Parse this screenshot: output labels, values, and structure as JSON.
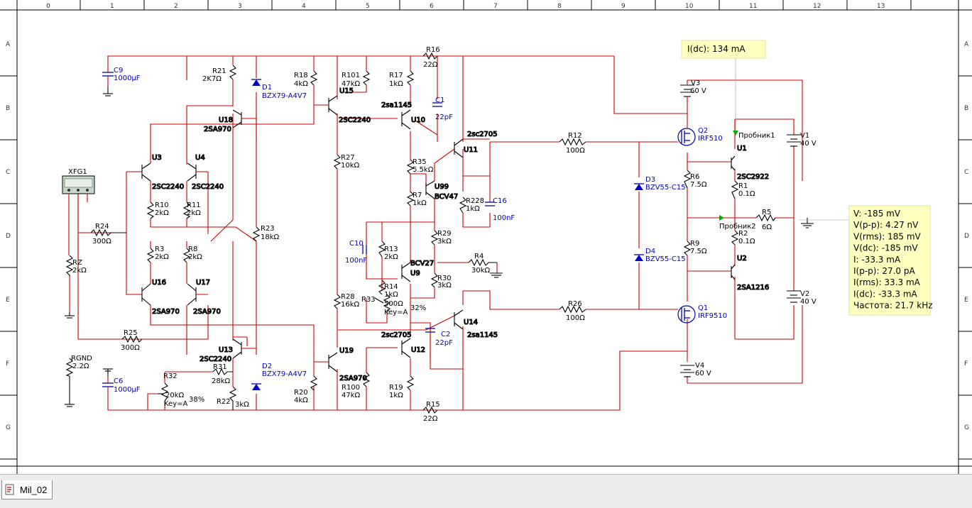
{
  "ruler": {
    "columns": [
      "0",
      "1",
      "2",
      "3",
      "4",
      "5",
      "6",
      "7",
      "8",
      "9",
      "10",
      "11",
      "12",
      "13"
    ],
    "rows": [
      "A",
      "B",
      "C",
      "D",
      "E",
      "F",
      "G"
    ]
  },
  "components": {
    "C9": {
      "ref": "C9",
      "val": "1000µF"
    },
    "C6": {
      "ref": "C6",
      "val": "1000µF"
    },
    "XFG1": {
      "ref": "XFG1"
    },
    "R24": {
      "ref": "R24",
      "val": "300Ω"
    },
    "RZ": {
      "ref": "RZ",
      "val": "2kΩ"
    },
    "R25": {
      "ref": "R25",
      "val": "300Ω"
    },
    "RGND": {
      "ref": "RGND",
      "val": "2.2Ω"
    },
    "U3": {
      "ref": "U3",
      "val": "2SC2240"
    },
    "U4": {
      "ref": "U4",
      "val": "2SC2240"
    },
    "R10": {
      "ref": "R10",
      "val": "2kΩ"
    },
    "R11": {
      "ref": "R11",
      "val": "2kΩ"
    },
    "R3": {
      "ref": "R3",
      "val": "2kΩ"
    },
    "R8": {
      "ref": "R8",
      "val": "2kΩ"
    },
    "U16": {
      "ref": "U16",
      "val": "2SA970"
    },
    "U17": {
      "ref": "U17",
      "val": "2SA970"
    },
    "R21": {
      "ref": "R21",
      "val": "2K7Ω"
    },
    "U18": {
      "ref": "U18",
      "val": "2SA970"
    },
    "D1": {
      "ref": "D1",
      "val": "BZX79-A4V7"
    },
    "D2": {
      "ref": "D2",
      "val": "BZX79-A4V7"
    },
    "R23": {
      "ref": "R23",
      "val": "18kΩ"
    },
    "U13": {
      "ref": "U13",
      "val": "2SC2240"
    },
    "R31": {
      "ref": "R31",
      "val": "28kΩ"
    },
    "R32": {
      "ref": "R32",
      "val": "20kΩ",
      "key": "Key=A",
      "pct": "38%"
    },
    "R22": {
      "ref": "R22",
      "val": "3kΩ"
    },
    "R18": {
      "ref": "R18",
      "val": "4kΩ"
    },
    "R20": {
      "ref": "R20",
      "val": "4kΩ"
    },
    "R101": {
      "ref": "R101",
      "val": "47kΩ"
    },
    "U15": {
      "ref": "U15",
      "val": "2SC2240"
    },
    "R27": {
      "ref": "R27",
      "val": "10kΩ"
    },
    "R28": {
      "ref": "R28",
      "val": "16kΩ"
    },
    "U19": {
      "ref": "U19",
      "val": "2SA970"
    },
    "R100": {
      "ref": "R100",
      "val": "47kΩ"
    },
    "R17": {
      "ref": "R17",
      "val": "1kΩ"
    },
    "U10": {
      "ref": "U10",
      "val": "2sa1145"
    },
    "R35": {
      "ref": "R35",
      "val": "5.5kΩ"
    },
    "U99": {
      "ref": "U99",
      "val": "BCV47"
    },
    "R7": {
      "ref": "R7",
      "val": "1kΩ"
    },
    "C10": {
      "ref": "C10",
      "val": "100nF"
    },
    "R13": {
      "ref": "R13",
      "val": "2kΩ"
    },
    "U9": {
      "ref": "U9",
      "val": "BCV27"
    },
    "R14": {
      "ref": "R14",
      "val": "1kΩ"
    },
    "R33": {
      "ref": "R33",
      "val": "500Ω",
      "key": "Key=A",
      "pct": "32%"
    },
    "U12": {
      "ref": "U12",
      "val": "2sc2705"
    },
    "R19": {
      "ref": "R19",
      "val": "1kΩ"
    },
    "R29": {
      "ref": "R29",
      "val": "3kΩ"
    },
    "R30": {
      "ref": "R30",
      "val": "3kΩ"
    },
    "C1": {
      "ref": "C1",
      "val": "22pF"
    },
    "C2": {
      "ref": "C2",
      "val": "22pF"
    },
    "R16": {
      "ref": "R16",
      "val": "22Ω"
    },
    "R15": {
      "ref": "R15",
      "val": "22Ω"
    },
    "U11": {
      "ref": "U11",
      "val": "2sc2705"
    },
    "U14": {
      "ref": "U14",
      "val": "2sa1145"
    },
    "R228": {
      "ref": "R228",
      "val": "1kΩ"
    },
    "C16": {
      "ref": "C16",
      "val": "100nF"
    },
    "R4": {
      "ref": "R4",
      "val": "30kΩ"
    },
    "R12": {
      "ref": "R12",
      "val": "100Ω"
    },
    "R26": {
      "ref": "R26",
      "val": "100Ω"
    },
    "D3": {
      "ref": "D3",
      "val": "BZV55-C15"
    },
    "D4": {
      "ref": "D4",
      "val": "BZV55-C15"
    },
    "V3": {
      "ref": "V3",
      "val": "60 V"
    },
    "V4": {
      "ref": "V4",
      "val": "60 V"
    },
    "Q2": {
      "ref": "Q2",
      "val": "IRF510"
    },
    "Q1": {
      "ref": "Q1",
      "val": "IRF9510"
    },
    "R6": {
      "ref": "R6",
      "val": "7.5Ω"
    },
    "R9": {
      "ref": "R9",
      "val": "7.5Ω"
    },
    "U1": {
      "ref": "U1",
      "val": "2SC2922"
    },
    "U2": {
      "ref": "U2",
      "val": "2SA1216"
    },
    "R1": {
      "ref": "R1",
      "val": "0.1Ω"
    },
    "R2": {
      "ref": "R2",
      "val": "0.1Ω"
    },
    "R5": {
      "ref": "R5",
      "val": "6Ω"
    },
    "V1": {
      "ref": "V1",
      "val": "40 V"
    },
    "V2": {
      "ref": "V2",
      "val": "40 V"
    }
  },
  "probes": {
    "probe1": "Пробник1",
    "probe2": "Пробник2",
    "probe_top_reading": "I(dc): 134 mA",
    "probe2_readings": [
      "V: -185 mV",
      "V(p-p): 4.27 nV",
      "V(rms): 185 mV",
      "V(dc): -185 mV",
      "I: -33.3 mA",
      "I(p-p): 27.0 pA",
      "I(rms): 33.3 mA",
      "I(dc): -33.3 mA",
      "Частота: 21.7 kHz"
    ]
  },
  "tabs": [
    {
      "label": "Mil_02",
      "icon": "schematic-sheet-icon"
    }
  ],
  "colors": {
    "wire": "#cc0000",
    "component": "#000000",
    "part_label": "#0000cc",
    "probe_bg": "#ffffc0"
  }
}
